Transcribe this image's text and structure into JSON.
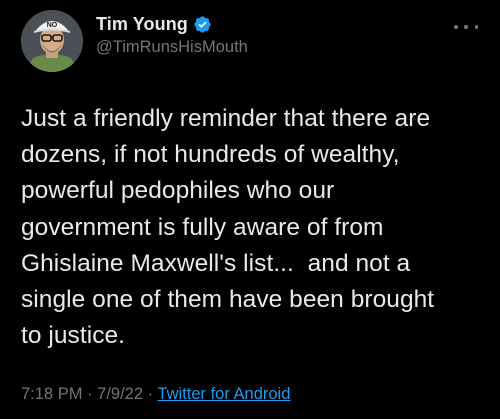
{
  "tweet": {
    "display_name": "Tim Young",
    "handle": "@TimRunsHisMouth",
    "verified": true,
    "avatar_cap_text": "NO",
    "body": "Just a friendly reminder that there are\ndozens, if not hundreds of wealthy,\npowerful pedophiles who our\ngovernment is fully aware of from\nGhislaine Maxwell's list...  and not a\nsingle one of them have been brought\nto justice.",
    "time": "7:18 PM",
    "separator": "·",
    "date": "7/9/22",
    "source": "Twitter for Android",
    "more_icon": "more-horizontal-icon",
    "verified_icon": "verified-badge-icon"
  },
  "colors": {
    "background": "#000000",
    "text_primary": "#e7e9ea",
    "text_secondary": "#71767b",
    "link": "#1d9bf0",
    "verified_badge": "#1d9bf0"
  }
}
